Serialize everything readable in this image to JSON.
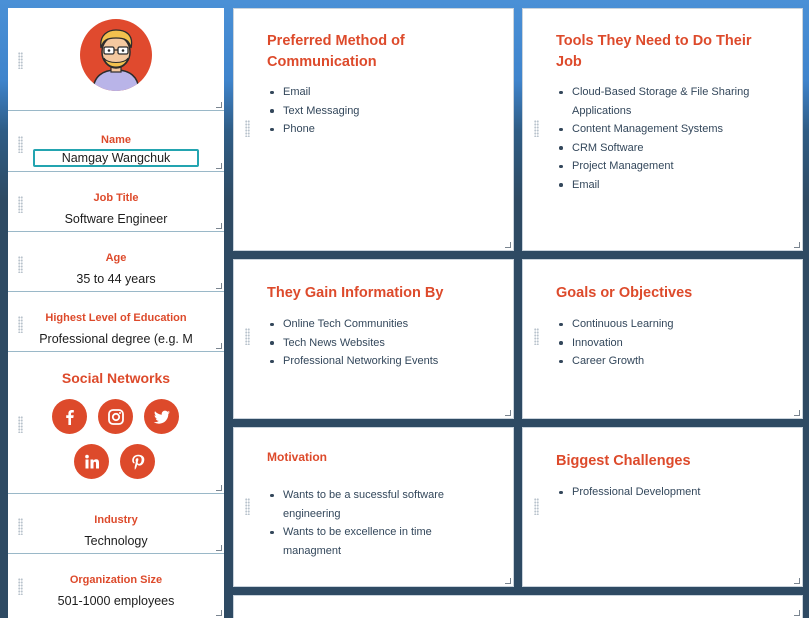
{
  "profile": {
    "name_label": "Name",
    "name_value": "Namgay Wangchuk",
    "job_title_label": "Job Title",
    "job_title_value": "Software Engineer",
    "age_label": "Age",
    "age_value": "35 to 44 years",
    "education_label": "Highest Level of Education",
    "education_value": "Professional degree (e.g. M",
    "social_title": "Social Networks",
    "social_icons": [
      "facebook-icon",
      "instagram-icon",
      "twitter-icon",
      "linkedin-icon",
      "pinterest-icon"
    ],
    "industry_label": "Industry",
    "industry_value": "Technology",
    "org_size_label": "Organization Size",
    "org_size_value": "501-1000 employees"
  },
  "cards": {
    "preferred": {
      "title": "Preferred Method of Communication",
      "items": [
        "Email",
        "Text Messaging",
        "Phone"
      ]
    },
    "tools": {
      "title": "Tools They Need to Do Their Job",
      "items": [
        "Cloud-Based Storage & File Sharing Applications",
        "Content Management Systems",
        "CRM Software",
        "Project Management",
        "Email"
      ]
    },
    "information": {
      "title": "They Gain Information By",
      "items": [
        "Online Tech Communities",
        "Tech News Websites",
        "Professional Networking Events"
      ]
    },
    "goals": {
      "title": "Goals or Objectives",
      "items": [
        "Continuous Learning",
        "Innovation",
        "Career Growth"
      ]
    },
    "motivation": {
      "title": "Motivation",
      "items": [
        "Wants to be a sucessful software engineering",
        "Wants to be excellence in time managment"
      ]
    },
    "challenges": {
      "title": "Biggest Challenges",
      "items": [
        "Professional Development"
      ]
    }
  },
  "colors": {
    "accent": "#dd4a2b",
    "text": "#33475b",
    "focus": "#23a4b0"
  }
}
